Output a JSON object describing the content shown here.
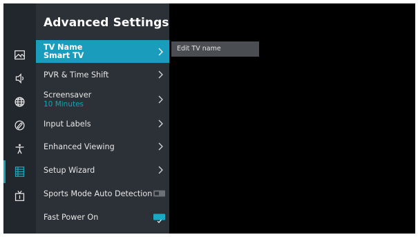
{
  "sidebar": {
    "icons": [
      {
        "name": "picture-icon"
      },
      {
        "name": "sound-icon"
      },
      {
        "name": "network-icon"
      },
      {
        "name": "remote-icon"
      },
      {
        "name": "accessibility-icon"
      },
      {
        "name": "advanced-settings-icon",
        "active": true
      },
      {
        "name": "tv-icon"
      }
    ]
  },
  "panel": {
    "title": "Advanced Settings",
    "items": [
      {
        "label": "TV Name",
        "value": "Smart TV",
        "type": "submenu",
        "selected": true
      },
      {
        "label": "PVR & Time Shift",
        "type": "submenu"
      },
      {
        "label": "Screensaver",
        "value": "10 Minutes",
        "type": "submenu"
      },
      {
        "label": "Input Labels",
        "type": "submenu"
      },
      {
        "label": "Enhanced Viewing",
        "type": "submenu"
      },
      {
        "label": "Setup Wizard",
        "type": "submenu"
      },
      {
        "label": "Sports Mode Auto Detection",
        "type": "toggle",
        "checked": false
      },
      {
        "label": "Fast Power On",
        "type": "toggle",
        "checked": true
      }
    ]
  },
  "tooltip": {
    "text": "Edit TV name"
  },
  "colors": {
    "accent": "#1a9dbd",
    "subvalue": "#12a3b3",
    "panel": "#2c3137",
    "iconbar": "#22272d"
  }
}
